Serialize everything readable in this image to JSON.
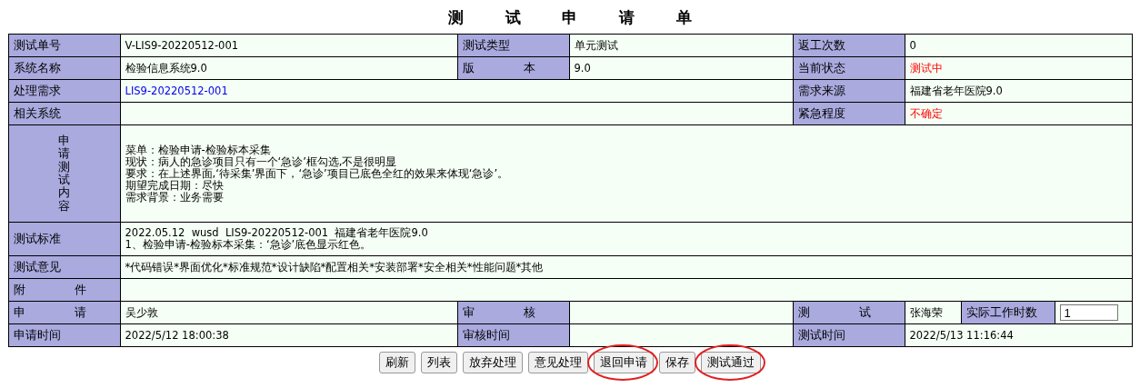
{
  "title": "测 试 申 请 单",
  "rows": [
    [
      {
        "kind": "label",
        "text": "测试单号"
      },
      {
        "kind": "value",
        "text": "V-LIS9-20220512-001"
      },
      {
        "kind": "label",
        "text": "测试类型"
      },
      {
        "kind": "value",
        "text": "单元测试"
      },
      {
        "kind": "label",
        "text": "返工次数"
      },
      {
        "kind": "value",
        "text": "0"
      }
    ],
    [
      {
        "kind": "label",
        "text": "系统名称"
      },
      {
        "kind": "value",
        "text": "检验信息系统9.0"
      },
      {
        "kind": "label",
        "text": "版 本"
      },
      {
        "kind": "value",
        "text": "9.0"
      },
      {
        "kind": "label",
        "text": "当前状态"
      },
      {
        "kind": "alert",
        "text": "测试中"
      }
    ],
    [
      {
        "kind": "label",
        "text": "处理需求"
      },
      {
        "kind": "link",
        "text": "LIS9-20220512-001"
      },
      {
        "kind": "label",
        "text": "需求来源"
      },
      {
        "kind": "value",
        "text": "福建省老年医院9.0"
      }
    ],
    [
      {
        "kind": "label",
        "text": "相关系统"
      },
      {
        "kind": "value"
      },
      {
        "kind": "label",
        "text": "紧急程度"
      },
      {
        "kind": "alert",
        "text": "不确定"
      }
    ],
    [
      {
        "kind": "vertical_label",
        "text": "申请测试内容"
      },
      {
        "kind": "lines",
        "lines": [
          "菜单：检验申请-检验标本采集",
          "现状：病人的急诊项目只有一个‘急诊’框勾选,不是很明显",
          "要求：在上述界面,‘待采集’界面下，‘急诊’项目已底色全红的效果来体现‘急诊’。",
          "期望完成日期：尽快",
          "需求背景：业务需要"
        ]
      }
    ],
    [
      {
        "kind": "label",
        "text": "测试标准"
      },
      {
        "kind": "lines",
        "lines": [
          "2022.05.12  wusd  LIS9-20220512-001  福建省老年医院9.0",
          "1、检验申请-检验标本采集：‘急诊’底色显示红色。"
        ]
      }
    ],
    [
      {
        "kind": "label",
        "text": "测试意见"
      },
      {
        "kind": "value",
        "text": "*代码错误*界面优化*标准规范*设计缺陷*配置相关*安装部署*安全相关*性能问题*其他"
      }
    ],
    [
      {
        "kind": "label",
        "text": "附 件"
      },
      {
        "kind": "value"
      }
    ],
    [
      {
        "kind": "label",
        "text": "申 请"
      },
      {
        "kind": "value",
        "text": "吴少敦"
      },
      {
        "kind": "label",
        "text": "审 核"
      },
      {
        "kind": "value"
      },
      {
        "kind": "label",
        "text": "测 试"
      },
      {
        "kind": "value",
        "text": "张海荣"
      },
      {
        "kind": "label",
        "text": "实际工作时数"
      },
      {
        "kind": "input",
        "text": "1"
      }
    ],
    [
      {
        "kind": "label",
        "text": "申请时间"
      },
      {
        "kind": "value",
        "text": "2022/5/12 18:00:38"
      },
      {
        "kind": "label",
        "text": "审核时间"
      },
      {
        "kind": "value"
      },
      {
        "kind": "label",
        "text": "测试时间"
      },
      {
        "kind": "value",
        "text": "2022/5/13 11:16:44"
      }
    ]
  ],
  "buttons": [
    {
      "label": "刷新",
      "circled": false
    },
    {
      "label": "列表",
      "circled": false
    },
    {
      "label": "放弃处理",
      "circled": false
    },
    {
      "label": "意见处理",
      "circled": false
    },
    {
      "label": "退回申请",
      "circled": true
    },
    {
      "label": "保存",
      "circled": false
    },
    {
      "label": "测试通过",
      "circled": true
    }
  ]
}
